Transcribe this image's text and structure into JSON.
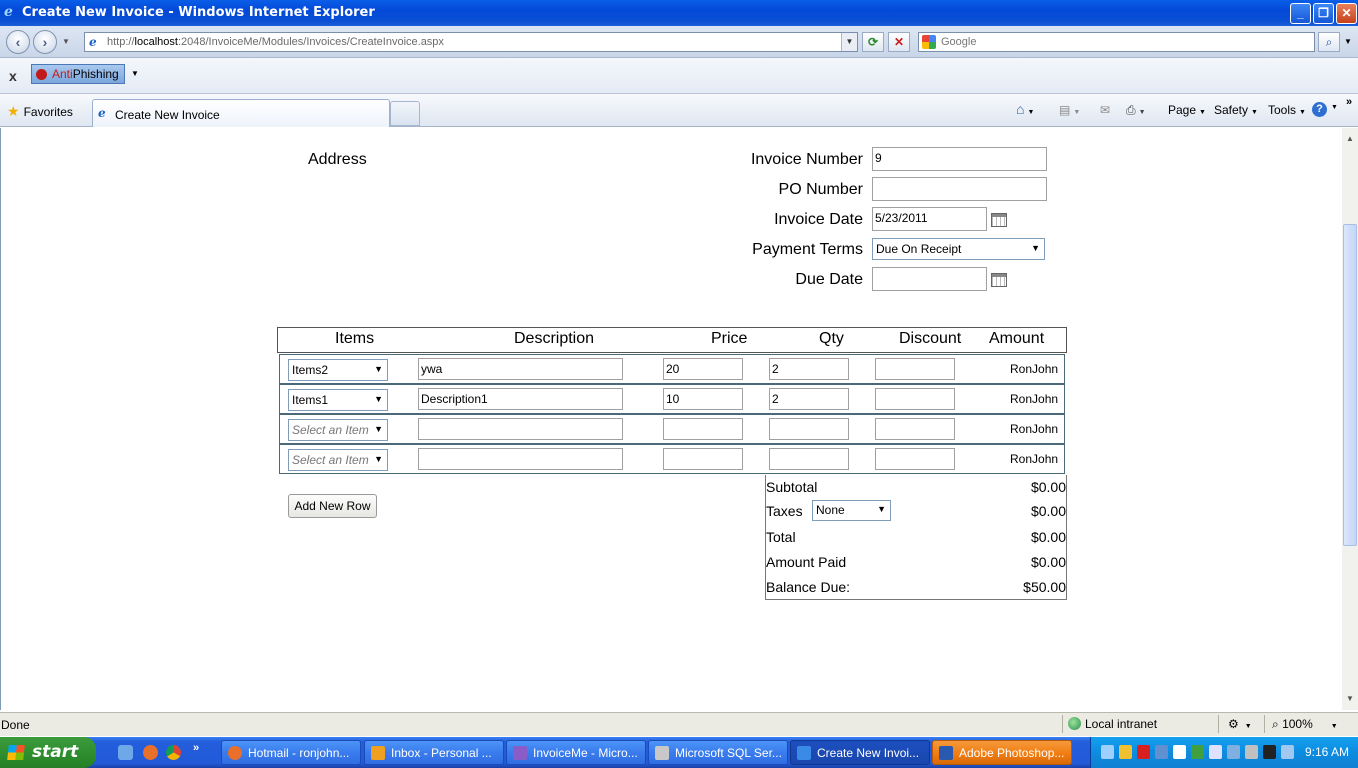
{
  "window": {
    "title": "Create New Invoice - Windows Internet Explorer",
    "min_label": "_",
    "max_label": "❐",
    "close_label": "✕"
  },
  "nav": {
    "url_prefix": "http://",
    "url_host": "localhost",
    "url_rest": ":2048/InvoiceMe/Modules/Invoices/CreateInvoice.aspx",
    "search_placeholder": "Google"
  },
  "toolbar": {
    "close_label": "x",
    "anti": "Anti",
    "phishing": "Phishing"
  },
  "tabs": {
    "favorites_label": "Favorites",
    "active_tab": "Create New Invoice",
    "page_label": "Page",
    "safety_label": "Safety",
    "tools_label": "Tools"
  },
  "form": {
    "address_label": "Address",
    "invoice_number_label": "Invoice Number",
    "invoice_number_value": "9",
    "po_number_label": "PO Number",
    "po_number_value": "",
    "invoice_date_label": "Invoice Date",
    "invoice_date_value": "5/23/2011",
    "payment_terms_label": "Payment Terms",
    "payment_terms_value": "Due On Receipt",
    "due_date_label": "Due Date",
    "due_date_value": ""
  },
  "grid": {
    "headers": [
      "Items",
      "Description",
      "Price",
      "Qty",
      "Discount",
      "Amount"
    ],
    "rows": [
      {
        "item": "Items2",
        "description": "ywa",
        "price": "20",
        "qty": "2",
        "discount": "",
        "amount": "RonJohn",
        "placeholder": false
      },
      {
        "item": "Items1",
        "description": "Description1",
        "price": "10",
        "qty": "2",
        "discount": "",
        "amount": "RonJohn",
        "placeholder": false
      },
      {
        "item": "Select an Item",
        "description": "",
        "price": "",
        "qty": "",
        "discount": "",
        "amount": "RonJohn",
        "placeholder": true
      },
      {
        "item": "Select an Item",
        "description": "",
        "price": "",
        "qty": "",
        "discount": "",
        "amount": "RonJohn",
        "placeholder": true
      }
    ],
    "add_row_label": "Add New Row"
  },
  "totals": {
    "subtotal_label": "Subtotal",
    "subtotal_value": "$0.00",
    "taxes_label": "Taxes",
    "taxes_select": "None",
    "taxes_value": "$0.00",
    "total_label": "Total",
    "total_value": "$0.00",
    "amount_paid_label": "Amount Paid",
    "amount_paid_value": "$0.00",
    "balance_due_label": "Balance Due:",
    "balance_due_value": "$50.00"
  },
  "status": {
    "text": "Done",
    "zone": "Local intranet",
    "zoom": "100%"
  },
  "taskbar": {
    "start_label": "start",
    "tasks": [
      {
        "label": "Hotmail - ronjohn...",
        "color": "#e8702a"
      },
      {
        "label": "Inbox - Personal ...",
        "color": "#f0a020"
      },
      {
        "label": "InvoiceMe - Micro...",
        "color": "#8a5cc8"
      },
      {
        "label": "Microsoft SQL Ser...",
        "color": "#c8c8c8"
      },
      {
        "label": "Create New Invoi...",
        "color": "#3a8ae8"
      },
      {
        "label": "Adobe Photoshop...",
        "color": "#2a5ab0"
      }
    ],
    "clock": "9:16 AM"
  },
  "colors": {
    "titlebar": "#0a4fd4",
    "taskbar": "#245edc",
    "start": "#2f8f2f",
    "active_task": "#f07a10"
  }
}
